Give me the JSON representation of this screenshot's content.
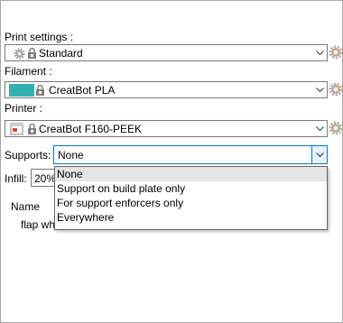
{
  "print_settings": {
    "label": "Print settings :",
    "value": "Standard"
  },
  "filament": {
    "label": "Filament :",
    "value": "CreatBot PLA",
    "color": "#2fb2b0"
  },
  "printer": {
    "label": "Printer :",
    "value": "CreatBot F160-PEEK"
  },
  "supports": {
    "label": "Supports:",
    "value": "None",
    "options": [
      "None",
      "Support on build plate only",
      "For support enforcers only",
      "Everywhere"
    ],
    "selected_index": 0
  },
  "infill": {
    "label": "Infill:",
    "value": "20%"
  },
  "objects": {
    "column_name": "Name",
    "row_text": "flap wh"
  },
  "colors": {
    "accent": "#0078d7",
    "gear": "#f5a623"
  }
}
